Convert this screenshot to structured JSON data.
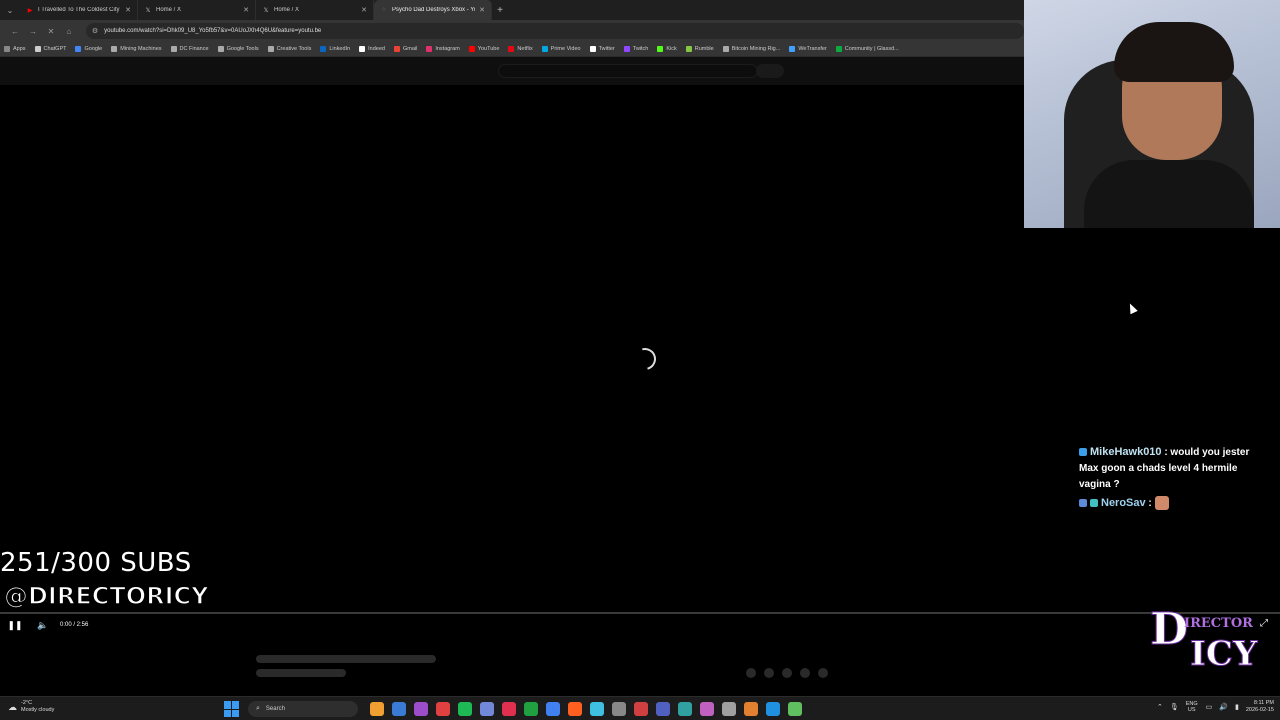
{
  "browser": {
    "tabs": [
      {
        "title": "I Travelled To The Coldest City",
        "favicon": "youtube-icon",
        "color": "#ff0000"
      },
      {
        "title": "Home / X",
        "favicon": "x-icon",
        "color": "#ffffff"
      },
      {
        "title": "Home / X",
        "favicon": "x-icon",
        "color": "#ffffff"
      },
      {
        "title": "Psycho Dad Destroys Xbox - Yo",
        "favicon": "youtube-icon",
        "color": "#ff0000",
        "active": true
      }
    ],
    "url": "youtube.com/watch?si=Dhk09_U8_Yo5fb57&v=0AUoJXh4Q6U&feature=youtu.be",
    "bookmarks": [
      {
        "label": "Apps",
        "color": "#888888"
      },
      {
        "label": "ChatGPT",
        "color": "#cccccc"
      },
      {
        "label": "Google",
        "color": "#4285f4"
      },
      {
        "label": "Mining Machines",
        "color": "#aaaaaa"
      },
      {
        "label": "DC Finance",
        "color": "#aaaaaa"
      },
      {
        "label": "Google Tools",
        "color": "#aaaaaa"
      },
      {
        "label": "Creative Tools",
        "color": "#aaaaaa"
      },
      {
        "label": "LinkedIn",
        "color": "#0a66c2"
      },
      {
        "label": "Indeed",
        "color": "#ffffff"
      },
      {
        "label": "Gmail",
        "color": "#ea4335"
      },
      {
        "label": "Instagram",
        "color": "#e1306c"
      },
      {
        "label": "YouTube",
        "color": "#ff0000"
      },
      {
        "label": "Netflix",
        "color": "#e50914"
      },
      {
        "label": "Prime Video",
        "color": "#00a8e1"
      },
      {
        "label": "Twitter",
        "color": "#ffffff"
      },
      {
        "label": "Twitch",
        "color": "#9146ff"
      },
      {
        "label": "Kick",
        "color": "#53fc18"
      },
      {
        "label": "Rumble",
        "color": "#85c742"
      },
      {
        "label": "Bitcoin Mining Rig...",
        "color": "#aaaaaa"
      },
      {
        "label": "WeTransfer",
        "color": "#409fff"
      },
      {
        "label": "Community | Glassd...",
        "color": "#0caa41"
      }
    ]
  },
  "player": {
    "time": "0:00 / 2:56",
    "progress": 0
  },
  "overlay": {
    "subs": "251/300 SUBS",
    "handle": "@DIRECTORICY",
    "chat": [
      {
        "user": "MikeHawk010",
        "text": " : would you jester Max goon a chads level 4 hermile vagina ?"
      },
      {
        "user": "NeroSav",
        "text": " :"
      }
    ],
    "logo": {
      "big1": "D",
      "small": "IRECTOR",
      "big2": "ICY"
    }
  },
  "taskbar": {
    "temperature": "-2°C",
    "weather": "Mostly cloudy",
    "search": "Search",
    "lang1": "ENG",
    "lang2": "US",
    "time": "8:11 PM",
    "date": "2026-02-15",
    "icon_colors": [
      "#f0a030",
      "#3a7bd5",
      "#9b4dca",
      "#e04040",
      "#1db954",
      "#7289da",
      "#e03050",
      "#20a040",
      "#4080f0",
      "#ff6020",
      "#40c0e0",
      "#888888",
      "#d04040",
      "#5060c0",
      "#30a0a0",
      "#c060c0",
      "#a0a0a0",
      "#e08030",
      "#2090e0",
      "#60c060"
    ]
  }
}
